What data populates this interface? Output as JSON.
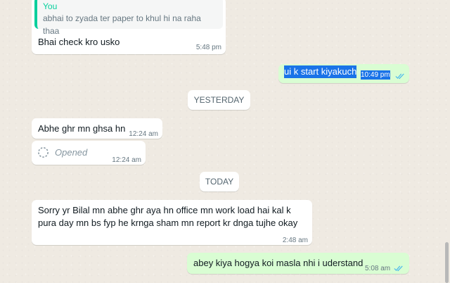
{
  "messages": {
    "m1": {
      "quote_author": "You",
      "quote_text": "abhai to zyada ter paper to khul hi na raha thaa",
      "text": "Bhai check kro usko",
      "time": "5:48 pm"
    },
    "m2": {
      "text": "ui k start kiyakuch",
      "time": "10:49 pm"
    },
    "date_yesterday": "YESTERDAY",
    "m3": {
      "text": "Abhe ghr mn ghsa hn",
      "time": "12:24 am"
    },
    "m4": {
      "text": "Opened",
      "time": "12:24 am"
    },
    "date_today": "TODAY",
    "m5": {
      "line1": "Sorry yr Bilal mn abhe ghr aya hn office mn work load hai kal  k",
      "line2": "pura day mn bs fyp he krnga sham mn report kr dnga tujhe okay",
      "time": "2:48 am"
    },
    "m6": {
      "text": "abey kiya hogya koi masla nhi i uderstand",
      "time": "5:08 am"
    }
  },
  "colors": {
    "background": "#efeae2",
    "incoming": "#ffffff",
    "outgoing": "#d9fdd3",
    "quote_accent": "#06cf9c",
    "read_ticks": "#53bdeb",
    "selection": "#1a73e8"
  },
  "icons": {
    "read_receipt": "double-check-icon",
    "view_once": "view-once-opened-icon"
  }
}
